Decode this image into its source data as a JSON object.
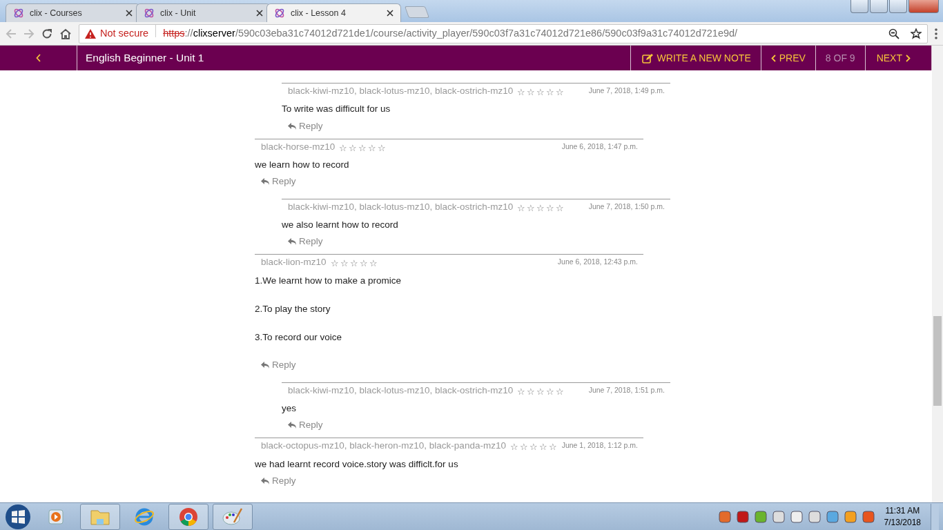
{
  "browser": {
    "tabs": [
      {
        "title": "clix - Courses",
        "selected": false
      },
      {
        "title": "clix - Unit",
        "selected": false
      },
      {
        "title": "clix - Lesson 4",
        "selected": true
      }
    ],
    "security": "Not secure",
    "url": {
      "scheme": "https",
      "separator": "://",
      "host": "clixserver",
      "path": "/590c03eba31c74012d721de1/course/activity_player/590c03f7a31c74012d721e86/590c03f9a31c74012d721e9d/"
    }
  },
  "app_bar": {
    "title": "English Beginner - Unit 1",
    "write_note": "WRITE A NEW NOTE",
    "prev": "PREV",
    "position": "8 OF 9",
    "next": "NEXT"
  },
  "comments": [
    {
      "children": [
        {
          "author": "black-kiwi-mz10, black-lotus-mz10, black-ostrich-mz10",
          "stars": 0,
          "date": "June 7, 2018, 1:49 p.m.",
          "paragraphs": [
            "To write was difficult for us"
          ],
          "reply_label": "Reply"
        }
      ]
    },
    {
      "author": "black-horse-mz10",
      "stars": 0,
      "date": "June 6, 2018, 1:47 p.m.",
      "paragraphs": [
        "we learn how to record"
      ],
      "reply_label": "Reply",
      "children": [
        {
          "author": "black-kiwi-mz10, black-lotus-mz10, black-ostrich-mz10",
          "stars": 0,
          "date": "June 7, 2018, 1:50 p.m.",
          "paragraphs": [
            "we also learnt how to record"
          ],
          "reply_label": "Reply"
        }
      ]
    },
    {
      "author": "black-lion-mz10",
      "stars": 0,
      "date": "June 6, 2018, 12:43 p.m.",
      "paragraphs": [
        "1.We learnt how to make a promice",
        "2.To play the story",
        "3.To record our voice"
      ],
      "reply_label": "Reply",
      "children": [
        {
          "author": "black-kiwi-mz10, black-lotus-mz10, black-ostrich-mz10",
          "stars": 0,
          "date": "June 7, 2018, 1:51 p.m.",
          "paragraphs": [
            "yes"
          ],
          "reply_label": "Reply"
        }
      ]
    },
    {
      "author": "black-octopus-mz10, black-heron-mz10, black-panda-mz10",
      "stars": 0,
      "date": "June 1, 2018, 1:12 p.m.",
      "paragraphs": [
        "we had learnt record voice.story was difficlt.for us"
      ],
      "reply_label": "Reply"
    }
  ],
  "taskbar": {
    "time": "11:31 AM",
    "date": "7/13/2018"
  }
}
